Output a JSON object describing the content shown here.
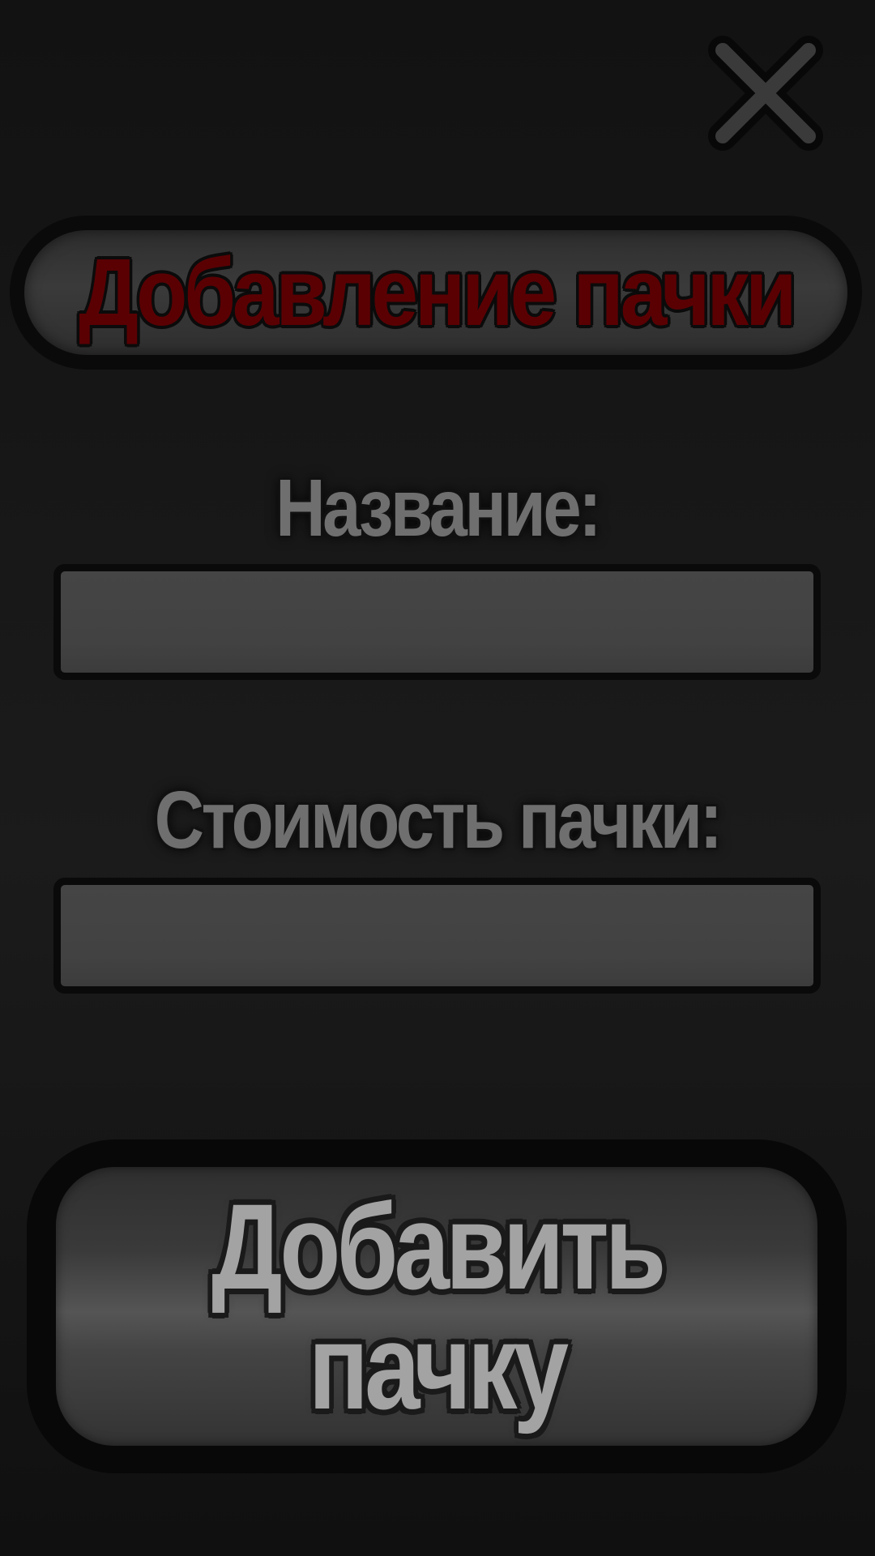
{
  "close_button": {
    "icon": "close-icon",
    "color": "#3a3a3a"
  },
  "header": {
    "title": "Добавление пачки",
    "title_color": "#5a0003"
  },
  "form": {
    "name_label": "Название:",
    "name_value": "",
    "price_label": "Стоимость пачки:",
    "price_value": ""
  },
  "add_button": {
    "line1": "Добавить",
    "line2": "пачку"
  }
}
